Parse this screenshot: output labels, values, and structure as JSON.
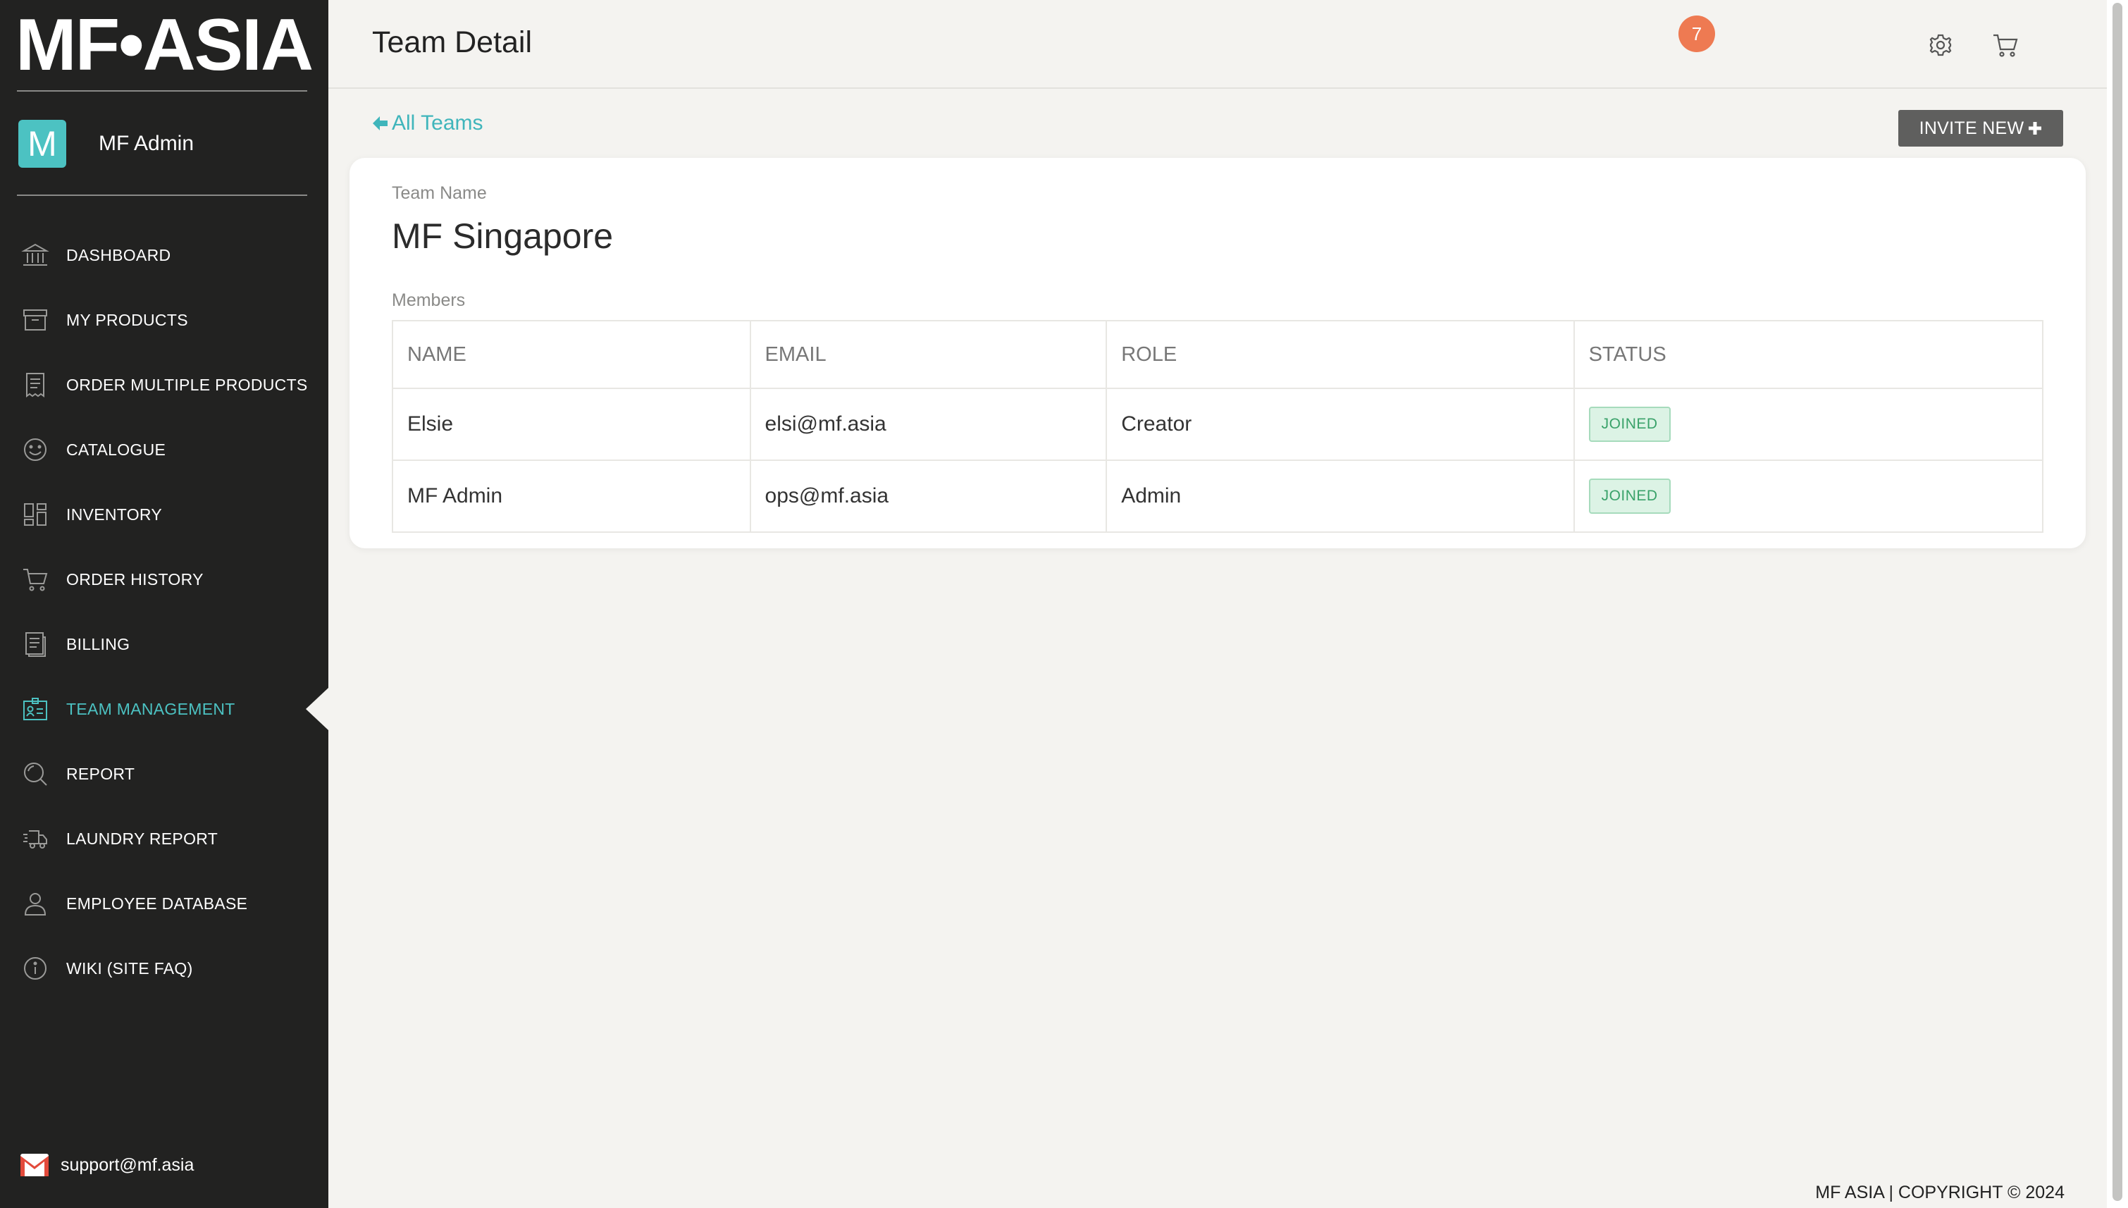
{
  "brand": {
    "logo_text": "MF•ASIA"
  },
  "user": {
    "initial": "M",
    "name": "MF Admin"
  },
  "sidebar": {
    "items": [
      {
        "label": "DASHBOARD",
        "icon": "bank-icon"
      },
      {
        "label": "MY PRODUCTS",
        "icon": "archive-box-icon"
      },
      {
        "label": "ORDER MULTIPLE PRODUCTS",
        "icon": "receipt-icon"
      },
      {
        "label": "CATALOGUE",
        "icon": "smiley-icon"
      },
      {
        "label": "INVENTORY",
        "icon": "grid-layout-icon"
      },
      {
        "label": "ORDER HISTORY",
        "icon": "cart-icon"
      },
      {
        "label": "BILLING",
        "icon": "document-icon"
      },
      {
        "label": "TEAM MANAGEMENT",
        "icon": "id-card-icon",
        "active": true
      },
      {
        "label": "REPORT",
        "icon": "magnifier-icon"
      },
      {
        "label": "LAUNDRY REPORT",
        "icon": "delivery-truck-icon"
      },
      {
        "label": "EMPLOYEE DATABASE",
        "icon": "person-icon"
      },
      {
        "label": "WIKI (SITE FAQ)",
        "icon": "info-circle-icon"
      }
    ],
    "support_email": "support@mf.asia"
  },
  "header": {
    "title": "Team Detail",
    "cart_count": "7"
  },
  "main": {
    "back_label": "All Teams",
    "invite_label": "INVITE NEW",
    "team_name_label": "Team Name",
    "team_name": "MF Singapore",
    "members_label": "Members",
    "table": {
      "columns": [
        "NAME",
        "EMAIL",
        "ROLE",
        "STATUS"
      ],
      "rows": [
        {
          "name": "Elsie",
          "email": "elsi@mf.asia",
          "role": "Creator",
          "status": "JOINED"
        },
        {
          "name": "MF Admin",
          "email": "ops@mf.asia",
          "role": "Admin",
          "status": "JOINED"
        }
      ]
    }
  },
  "footer": {
    "copyright": "MF ASIA | COPYRIGHT © 2024"
  },
  "colors": {
    "sidebar_bg": "#222221",
    "accent": "#4cc2c2",
    "badge_cart": "#ee7a52",
    "status_joined": "#3aa26a",
    "button_bg": "#5f5f5e"
  }
}
